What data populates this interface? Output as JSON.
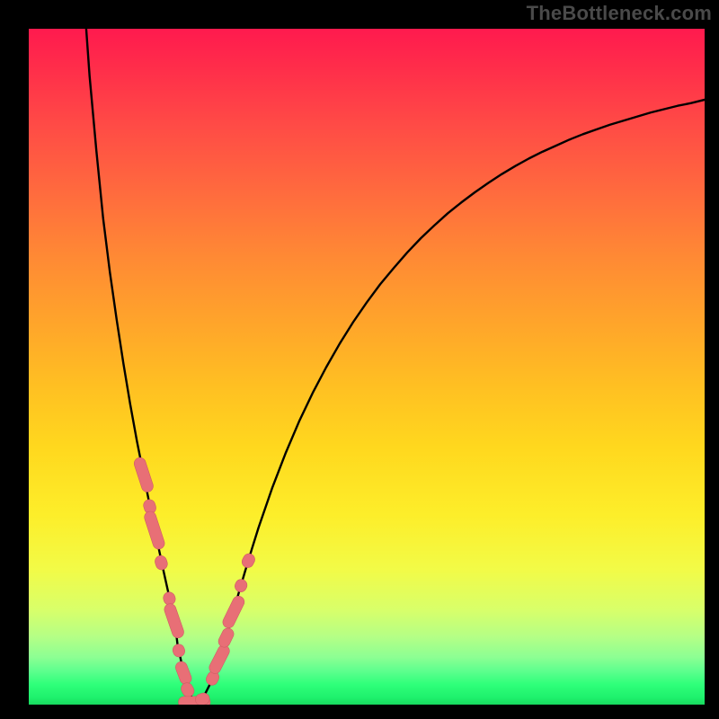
{
  "watermark": {
    "text": "TheBottleneck.com"
  },
  "colors": {
    "frame": "#000000",
    "curve_stroke": "#000000",
    "marker_fill": "#e86f76",
    "marker_stroke": "#cf5d64"
  },
  "chart_data": {
    "type": "line",
    "title": "",
    "xlabel": "",
    "ylabel": "",
    "xlim": [
      0,
      100
    ],
    "ylim": [
      0,
      100
    ],
    "grid": false,
    "legend": false,
    "series": [
      {
        "name": "bottleneck-curve",
        "x": [
          8.5,
          9,
          10,
          11,
          12,
          13,
          14,
          15,
          16,
          17,
          18,
          19,
          20,
          21,
          21.7,
          22,
          23,
          24,
          24.5,
          25,
          26,
          27,
          28,
          29,
          30,
          31,
          32,
          33,
          34,
          36,
          38,
          40,
          42,
          44,
          46,
          48,
          50,
          52,
          54,
          56,
          58,
          60,
          62,
          64,
          66,
          68,
          70,
          72,
          74,
          76,
          78,
          80,
          82,
          84,
          86,
          88,
          90,
          92,
          94,
          96,
          98,
          100
        ],
        "y": [
          100,
          93,
          82,
          72,
          64,
          57,
          50.5,
          44.5,
          39,
          34,
          29,
          24.2,
          19.5,
          15,
          11.5,
          9,
          4.3,
          1.3,
          0.3,
          0.3,
          1.4,
          3.4,
          6.1,
          9.3,
          12.8,
          16.3,
          19.7,
          23,
          26.2,
          32,
          37.2,
          41.9,
          46.1,
          49.9,
          53.4,
          56.6,
          59.5,
          62.2,
          64.6,
          66.9,
          69,
          70.9,
          72.7,
          74.3,
          75.8,
          77.2,
          78.5,
          79.7,
          80.8,
          81.8,
          82.7,
          83.6,
          84.4,
          85.1,
          85.8,
          86.4,
          87,
          87.6,
          88.1,
          88.6,
          89,
          89.5
        ]
      }
    ],
    "markers": [
      {
        "name": "left-cluster",
        "shape": "rounded-rect",
        "points": [
          {
            "x": 17.0,
            "y": 34.0,
            "len": 5.0,
            "angle": -72
          },
          {
            "x": 17.9,
            "y": 29.3,
            "len": 2.0,
            "angle": -72
          },
          {
            "x": 18.6,
            "y": 25.8,
            "len": 5.5,
            "angle": -72
          },
          {
            "x": 19.6,
            "y": 21.0,
            "len": 2.0,
            "angle": -72
          },
          {
            "x": 20.8,
            "y": 15.7,
            "len": 1.8,
            "angle": -71
          },
          {
            "x": 21.5,
            "y": 12.4,
            "len": 5.0,
            "angle": -71
          },
          {
            "x": 22.2,
            "y": 8.0,
            "len": 1.8,
            "angle": -70
          },
          {
            "x": 22.9,
            "y": 4.7,
            "len": 3.3,
            "angle": -69
          },
          {
            "x": 23.5,
            "y": 2.2,
            "len": 2.0,
            "angle": -60
          }
        ]
      },
      {
        "name": "trough-cluster",
        "shape": "rounded-rect",
        "points": [
          {
            "x": 24.5,
            "y": 0.35,
            "len": 4.5,
            "angle": 0
          },
          {
            "x": 25.7,
            "y": 0.8,
            "len": 2.0,
            "angle": 18
          }
        ]
      },
      {
        "name": "right-cluster",
        "shape": "rounded-rect",
        "points": [
          {
            "x": 27.2,
            "y": 3.9,
            "len": 2.0,
            "angle": 62
          },
          {
            "x": 28.2,
            "y": 6.7,
            "len": 4.3,
            "angle": 63
          },
          {
            "x": 29.2,
            "y": 9.9,
            "len": 2.8,
            "angle": 64
          },
          {
            "x": 30.3,
            "y": 13.7,
            "len": 4.8,
            "angle": 64
          },
          {
            "x": 31.4,
            "y": 17.6,
            "len": 1.8,
            "angle": 64
          },
          {
            "x": 32.5,
            "y": 21.3,
            "len": 2.0,
            "angle": 63
          }
        ]
      }
    ]
  }
}
